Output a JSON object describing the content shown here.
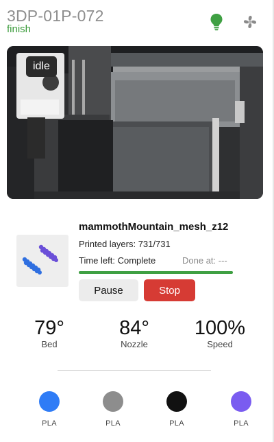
{
  "header": {
    "printer_name": "3DP-01P-072",
    "status": "finish",
    "light_icon": "lightbulb-icon",
    "fan_icon": "fan-icon",
    "light_color": "#3fa043"
  },
  "camera": {
    "state": "idle"
  },
  "job": {
    "file_name": "mammothMountain_mesh_z12",
    "layers_text": "Printed layers: 731/731",
    "time_left_text": "Time left: Complete",
    "done_at_text": "Done at: ---",
    "progress_fraction": 1.0,
    "pause_label": "Pause",
    "stop_label": "Stop",
    "accent": "#3fa043",
    "stop_color": "#d63b34"
  },
  "stats": {
    "bed": {
      "value": "79°",
      "label": "Bed"
    },
    "nozzle": {
      "value": "84°",
      "label": "Nozzle"
    },
    "speed": {
      "value": "100%",
      "label": "Speed"
    }
  },
  "materials": [
    {
      "label": "PLA",
      "color": "#2f7cf6"
    },
    {
      "label": "PLA",
      "color": "#8d8d8d"
    },
    {
      "label": "PLA",
      "color": "#111111"
    },
    {
      "label": "PLA",
      "color": "#7a5cf0"
    }
  ]
}
